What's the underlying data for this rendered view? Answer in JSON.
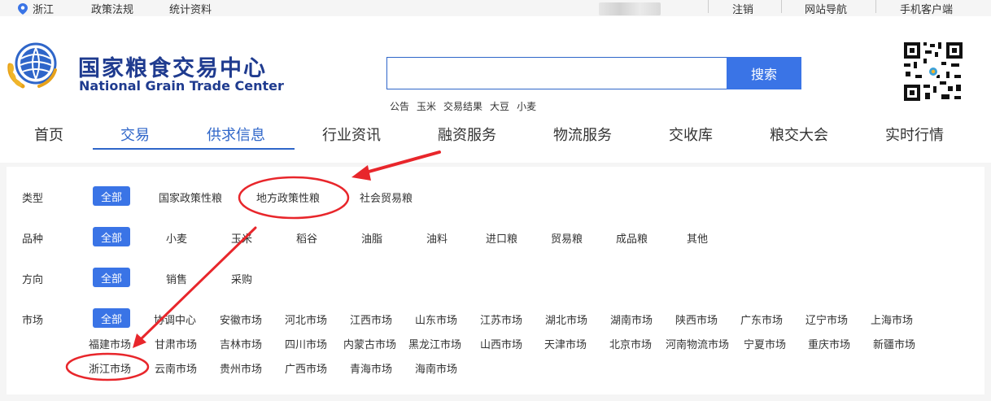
{
  "topbar": {
    "location": "浙江",
    "links": [
      "政策法规",
      "统计资料"
    ],
    "right_links": [
      "注销",
      "网站导航",
      "手机客户端"
    ]
  },
  "header": {
    "logo_cn": "国家粮食交易中心",
    "logo_en": "National Grain Trade Center",
    "search_button": "搜索",
    "search_value": "",
    "hot_keywords": [
      "公告",
      "玉米",
      "交易结果",
      "大豆",
      "小麦"
    ]
  },
  "nav": {
    "items": [
      "首页",
      "交易",
      "供求信息",
      "行业资讯",
      "融资服务",
      "物流服务",
      "交收库",
      "粮交大会",
      "实时行情"
    ]
  },
  "filters": {
    "type": {
      "label": "类型",
      "options": [
        "全部",
        "国家政策性粮",
        "地方政策性粮",
        "社会贸易粮"
      ]
    },
    "variety": {
      "label": "品种",
      "options": [
        "全部",
        "小麦",
        "玉米",
        "稻谷",
        "油脂",
        "油料",
        "进口粮",
        "贸易粮",
        "成品粮",
        "其他"
      ]
    },
    "direction": {
      "label": "方向",
      "options": [
        "全部",
        "销售",
        "采购"
      ]
    },
    "market": {
      "label": "市场",
      "options": [
        "全部",
        "协调中心",
        "安徽市场",
        "河北市场",
        "江西市场",
        "山东市场",
        "江苏市场",
        "湖北市场",
        "湖南市场",
        "陕西市场",
        "广东市场",
        "辽宁市场",
        "上海市场",
        "福建市场",
        "甘肃市场",
        "吉林市场",
        "四川市场",
        "内蒙古市场",
        "黑龙江市场",
        "山西市场",
        "天津市场",
        "北京市场",
        "河南物流市场",
        "宁夏市场",
        "重庆市场",
        "新疆市场",
        "浙江市场",
        "云南市场",
        "贵州市场",
        "广西市场",
        "青海市场",
        "海南市场"
      ]
    }
  },
  "colors": {
    "accent": "#3a74e6",
    "brand": "#1f3b8f",
    "annotation": "#e8262b"
  }
}
